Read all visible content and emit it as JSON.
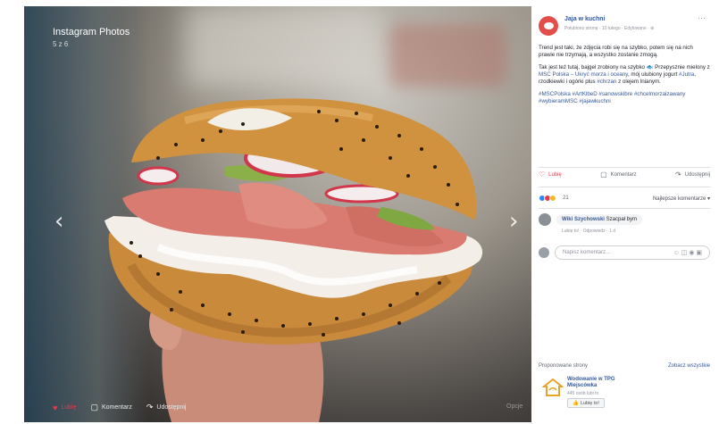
{
  "viewer": {
    "title": "Instagram Photos",
    "counter": "5 z 6",
    "prev_arrow": "‹",
    "next_arrow": "›",
    "actions": {
      "like_icon": "heart-icon",
      "like_label": "Lubię",
      "comment_icon": "comment-icon",
      "comment_label": "Komentarz",
      "share_icon": "share-icon",
      "share_label": "Udostępnij"
    },
    "options_label": "Opcje"
  },
  "page": {
    "name": "Jaja w kuchni",
    "meta": "Polubiono stronę · 10 lutego · Edytowane · ⊕",
    "more": "···",
    "avatar_color": "#e24f4a"
  },
  "post": {
    "p1": "Trend jest taki, że zdjęcia robi się na szybko, potem się na nich prawie nie trzymają, a wszystko zostanie zmogą.",
    "p2_a": "Tak jest też tutaj, bajgel zrobiony na szybko ",
    "p2_icon": "🐟",
    "p2_b": "Przepysznie mielony z ",
    "p2_link1": "MSC Polska – Ukryć morza i oceany",
    "p2_c": ", mój ulubiony jogurt ",
    "p2_link2": "#Jutra",
    "p2_d": ", rzodkiewki i ogórki plus ",
    "p2_link3": "#chrzan",
    "p2_e": " z olejem lnianym.",
    "tags": "#MSCPolska #ArtKlbeD #sanowskibre #chcelmorzaizawany #wybieramMSC #jajawkuchni"
  },
  "actions": {
    "like_icon": "heart-icon",
    "like": "Lubię",
    "comment_icon": "comment-icon",
    "comment": "Komentarz",
    "share_icon": "share-icon",
    "share": "Udostępnij"
  },
  "reactions": {
    "count": "21",
    "sort": "Najlepsze komentarze ▾",
    "colors": [
      "#2d88ff",
      "#e8394d",
      "#f7b928"
    ]
  },
  "comment": {
    "author": "Wiki Szychowski",
    "text": "Szacpał bym ",
    "meta": "Lubię to! · Odpowiedz · 1 d"
  },
  "write": {
    "placeholder": "Napisz komentarz...",
    "icons": "☺ ◫ ◉ ▣"
  },
  "suggest": {
    "title": "Proponowane strony",
    "see_all": "Zobacz wszystkie",
    "name": "Wodowanie w TPG Miejscówka",
    "likes": "445 osób lubi to",
    "button_icon": "thumb-icon",
    "button": "Lubię to!"
  }
}
